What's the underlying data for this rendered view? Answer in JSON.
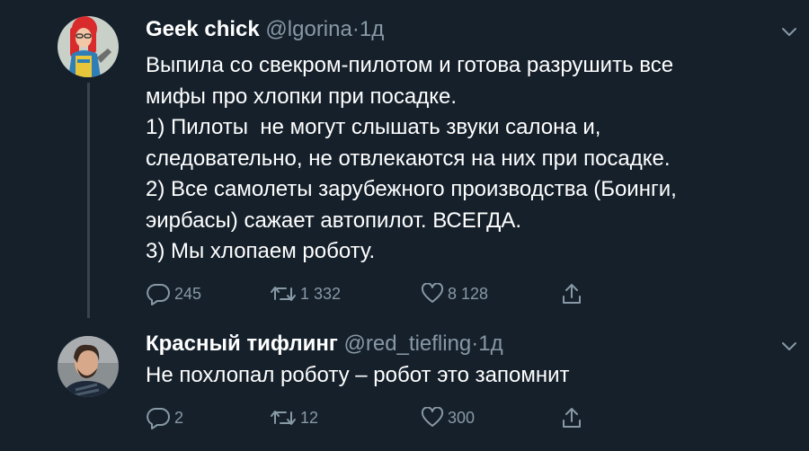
{
  "tweets": [
    {
      "name": "Geek chick",
      "handle": "@lgorina",
      "dot": "·",
      "time": "1д",
      "body": [
        "Выпила со свекром-пилотом и готова разрушить все",
        "мифы про хлопки при посадке.",
        "1) Пилоты  не могут слышать звуки салона и,",
        "следовательно, не отвлекаются на них при посадке.",
        "2) Все самолеты зарубежного производства (Боинги,",
        "эирбасы) сажает автопилот. ВСЕГДА.",
        "3) Мы хлопаем роботу."
      ],
      "replies": "245",
      "retweets": "1 332",
      "likes": "8 128"
    },
    {
      "name": "Красный тифлинг",
      "handle": "@red_tiefling",
      "dot": "·",
      "time": "1д",
      "body": [
        "Не похлопал роботу – робот это запомнит"
      ],
      "replies": "2",
      "retweets": "12",
      "likes": "300"
    }
  ],
  "icons": {
    "reply": "reply-icon",
    "retweet": "retweet-icon",
    "like": "heart-icon",
    "share": "share-icon",
    "more": "chevron-down-icon"
  },
  "colors": {
    "background": "#15202b",
    "text": "#ffffff",
    "secondary": "#8899a6",
    "thread_line": "#38444d"
  }
}
